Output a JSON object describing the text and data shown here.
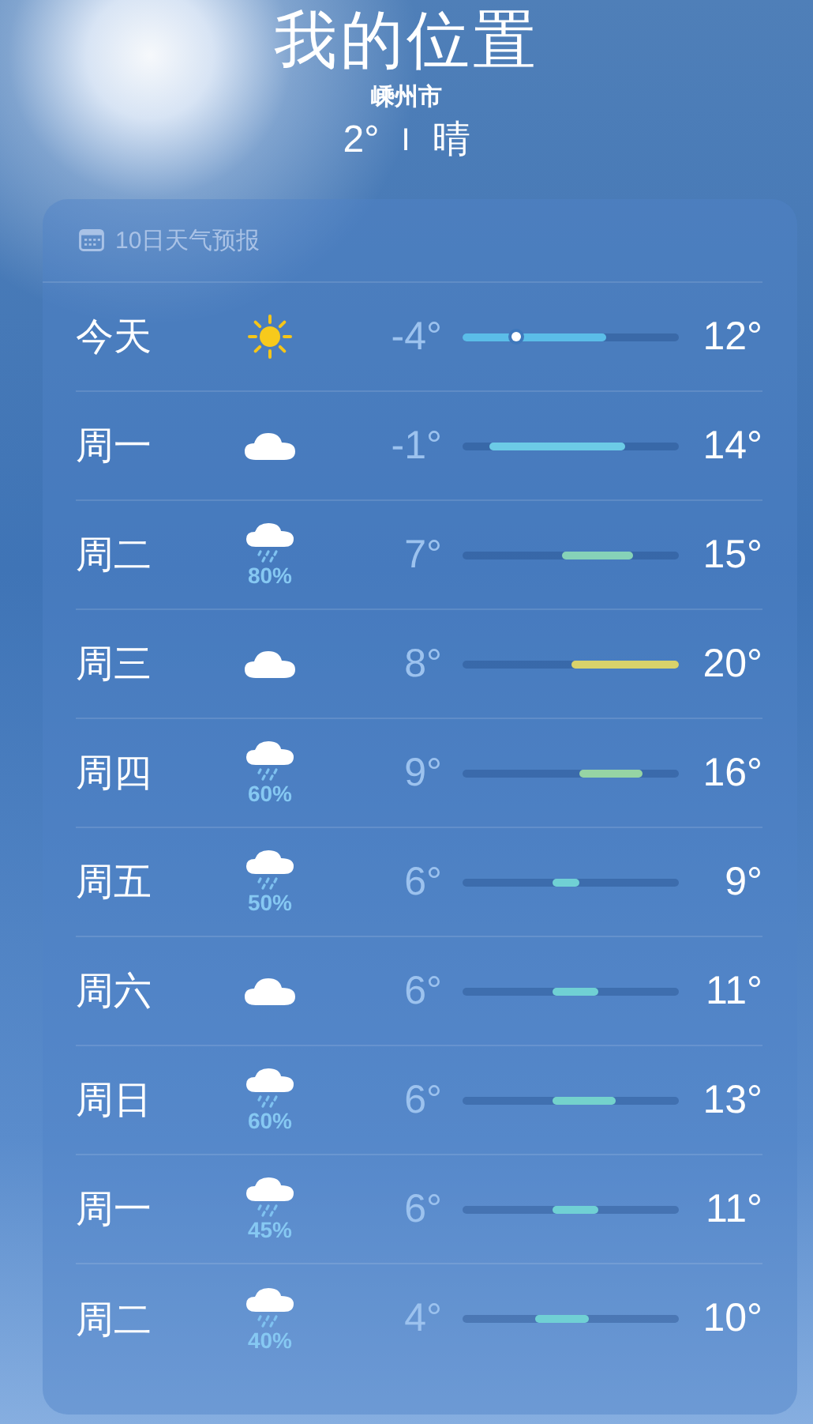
{
  "location": {
    "title": "我的位置",
    "city": "嵊州市",
    "current": "2°",
    "separator": "I",
    "condition": "晴"
  },
  "forecast": {
    "header": "10日天气预报",
    "days": [
      {
        "day": "今天",
        "kind": "sun",
        "low": "-4°",
        "high": "12°",
        "color": "#5bbde8",
        "now": true
      },
      {
        "day": "周一",
        "kind": "cloud",
        "low": "-1°",
        "high": "14°",
        "color": "#6ccbe6",
        "now": false
      },
      {
        "day": "周二",
        "kind": "rain",
        "chance": "80%",
        "low": "7°",
        "high": "15°",
        "color": "#86d2b8",
        "now": false
      },
      {
        "day": "周三",
        "kind": "cloud",
        "low": "8°",
        "high": "20°",
        "color": "#d9d26a",
        "now": false
      },
      {
        "day": "周四",
        "kind": "rain",
        "chance": "60%",
        "low": "9°",
        "high": "16°",
        "color": "#96d4a4",
        "now": false
      },
      {
        "day": "周五",
        "kind": "rain",
        "chance": "50%",
        "low": "6°",
        "high": "9°",
        "color": "#70d0d4",
        "now": false
      },
      {
        "day": "周六",
        "kind": "cloud",
        "low": "6°",
        "high": "11°",
        "color": "#70d0d4",
        "now": false
      },
      {
        "day": "周日",
        "kind": "rain",
        "chance": "60%",
        "low": "6°",
        "high": "13°",
        "color": "#74d2cc",
        "now": false
      },
      {
        "day": "周一",
        "kind": "rain",
        "chance": "45%",
        "low": "6°",
        "high": "11°",
        "color": "#70d0d4",
        "now": false
      },
      {
        "day": "周二",
        "kind": "rain",
        "chance": "40%",
        "low": "4°",
        "high": "10°",
        "color": "#70d0d4",
        "now": false
      }
    ]
  }
}
